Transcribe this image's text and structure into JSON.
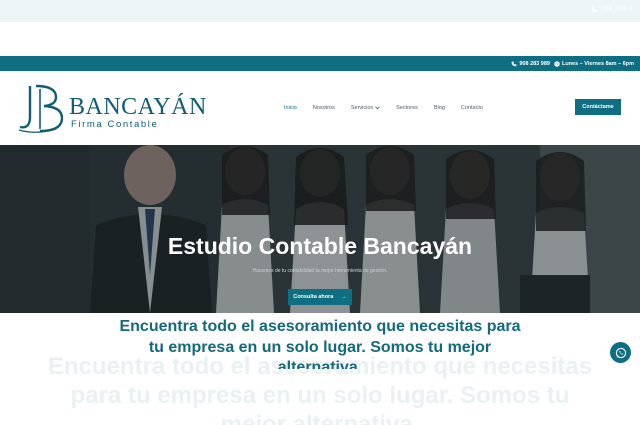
{
  "ghost_topbar": {
    "phone": "908 283 9"
  },
  "topbar": {
    "phone": "908 283 989",
    "hours": "Lunes – Viernes 8am – 6pm"
  },
  "header": {
    "logo_name": "BANCAYÁN",
    "logo_sub": "Firma Contable",
    "nav": [
      {
        "label": "Inicio"
      },
      {
        "label": "Nosotros"
      },
      {
        "label": "Servicios"
      },
      {
        "label": "Sectores"
      },
      {
        "label": "Blog"
      },
      {
        "label": "Contacto"
      }
    ],
    "cta_label": "Contáctame"
  },
  "hero": {
    "title": "Estudio Contable Bancayán",
    "subtitle": "Hacemos de tu contabilidad tu mejor herramienta de gestión.",
    "button_label": "Consulta ahora",
    "button_arrow": "→"
  },
  "intro": {
    "text": "Encuentra todo el asesoramiento que necesitas para tu empresa en un solo lugar. Somos tu mejor alternativa."
  },
  "colors": {
    "brand": "#0f6f82",
    "heading": "#136a7c"
  },
  "icons": {
    "phone": "phone-icon",
    "clock": "clock-icon",
    "whatsapp": "whatsapp-icon",
    "chevron": "chevron-down-icon"
  }
}
